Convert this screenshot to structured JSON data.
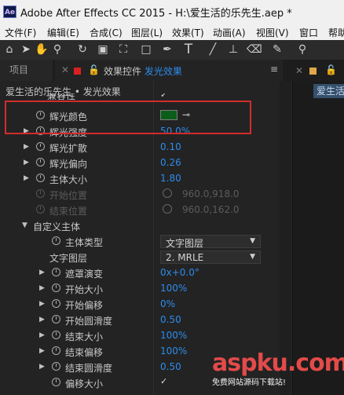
{
  "titlebar": {
    "app_icon": "Ae",
    "title": "Adobe After Effects CC 2015 - H:\\爱生活的乐先生.aep *"
  },
  "menu": [
    "文件(F)",
    "编辑(E)",
    "合成(C)",
    "图层(L)",
    "效果(T)",
    "动画(A)",
    "视图(V)",
    "窗口",
    "帮助"
  ],
  "toolbar_icons": [
    "home-icon",
    "selection-tool-icon",
    "hand-tool-icon",
    "zoom-tool-icon",
    "rotate-tool-icon",
    "camera-tool-icon",
    "pan-behind-tool-icon",
    "rectangle-tool-icon",
    "pen-tool-icon",
    "text-tool-icon",
    "brush-tool-icon",
    "clone-stamp-tool-icon",
    "eraser-tool-icon",
    "roto-brush-tool-icon",
    "puppet-pin-tool-icon"
  ],
  "tabs": {
    "project": "项目",
    "effects_prefix": "效果控件",
    "effects_layer": "发光效果",
    "menu_glyph": "≡",
    "right_button": "爱生活"
  },
  "subheader": "爱生活的乐先生 • 发光效果",
  "properties": [
    {
      "label": "兼容性",
      "value": "✓"
    },
    {
      "label": "辉光颜色",
      "value": ""
    },
    {
      "label": "辉光强度",
      "value": "50.0%"
    },
    {
      "label": "辉光扩散",
      "value": "0.10"
    },
    {
      "label": "辉光偏向",
      "value": "0.26"
    },
    {
      "label": "主体大小",
      "value": "1.80"
    },
    {
      "label": "开始位置",
      "value": "960.0,918.0"
    },
    {
      "label": "结束位置",
      "value": "960.0,162.0"
    },
    {
      "label": "自定义主体",
      "value": ""
    },
    {
      "label": "主体类型",
      "value": "文字图层"
    },
    {
      "label": "文字图层",
      "value": "2. MRLE"
    },
    {
      "label": "遮罩演变",
      "value": "0x+0.0°"
    },
    {
      "label": "开始大小",
      "value": "100%"
    },
    {
      "label": "开始偏移",
      "value": "0%"
    },
    {
      "label": "开始圆滑度",
      "value": "0.50"
    },
    {
      "label": "结束大小",
      "value": "100%"
    },
    {
      "label": "结束偏移",
      "value": "100%"
    },
    {
      "label": "结束圆滑度",
      "value": "0.50"
    },
    {
      "label": "偏移大小",
      "value": "✓"
    }
  ],
  "glow_color": "#0a5e1a",
  "watermark": {
    "logo": "aspku.com",
    "subtitle": "免费网站源码下载站!"
  }
}
